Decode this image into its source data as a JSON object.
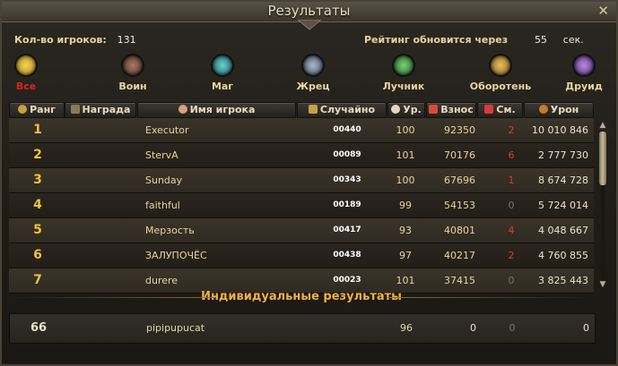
{
  "window": {
    "title": "Результаты",
    "close": "✕"
  },
  "info": {
    "players_label": "Кол-во игроков:",
    "players_value": "131",
    "refresh_label": "Рейтинг обновится через",
    "refresh_value": "55",
    "refresh_unit": "сек."
  },
  "classes": [
    {
      "label": "Все",
      "icon": "smiley-icon",
      "color": "#c9a52a"
    },
    {
      "label": "Воин",
      "icon": "warrior-icon",
      "color": "#7a4a3a"
    },
    {
      "label": "Маг",
      "icon": "mage-icon",
      "color": "#2a8a8a"
    },
    {
      "label": "Жрец",
      "icon": "priest-icon",
      "color": "#6a7a8a"
    },
    {
      "label": "Лучник",
      "icon": "archer-icon",
      "color": "#3a8a3a"
    },
    {
      "label": "Оборотень",
      "icon": "werewolf-icon",
      "color": "#b88a2a"
    },
    {
      "label": "Друид",
      "icon": "druid-icon",
      "color": "#7a4aa0"
    }
  ],
  "headers": {
    "rank": "Ранг",
    "reward": "Награда",
    "name": "Имя игрока",
    "random": "Случайно",
    "level": "Ур.",
    "contribution": "Взнос",
    "deaths": "См.",
    "damage": "Урон"
  },
  "rows": [
    {
      "rank": "1",
      "name": "Executor",
      "random": "00440",
      "level": "100",
      "contribution": "92350",
      "deaths": "2",
      "damage": "10 010 846"
    },
    {
      "rank": "2",
      "name": "StervA",
      "random": "00089",
      "level": "101",
      "contribution": "70176",
      "deaths": "6",
      "damage": "2 777 730"
    },
    {
      "rank": "3",
      "name": "Sunday",
      "random": "00343",
      "level": "100",
      "contribution": "67696",
      "deaths": "1",
      "damage": "8 674 728"
    },
    {
      "rank": "4",
      "name": "faithful",
      "random": "00189",
      "level": "99",
      "contribution": "54153",
      "deaths": "0",
      "damage": "5 724 014"
    },
    {
      "rank": "5",
      "name": "Мерзость",
      "random": "00417",
      "level": "93",
      "contribution": "40801",
      "deaths": "4",
      "damage": "4 048 667"
    },
    {
      "rank": "6",
      "name": "ЗАЛУПОЧЁС",
      "random": "00438",
      "level": "97",
      "contribution": "40217",
      "deaths": "2",
      "damage": "4 760 855"
    },
    {
      "rank": "7",
      "name": "durere",
      "random": "00023",
      "level": "101",
      "contribution": "37415",
      "deaths": "0",
      "damage": "3 825 443"
    }
  ],
  "individual": {
    "title": "Индивидуальные результаты",
    "rank": "66",
    "name": "pipipupucat",
    "level": "96",
    "contribution": "0",
    "deaths": "0",
    "damage": "0"
  }
}
